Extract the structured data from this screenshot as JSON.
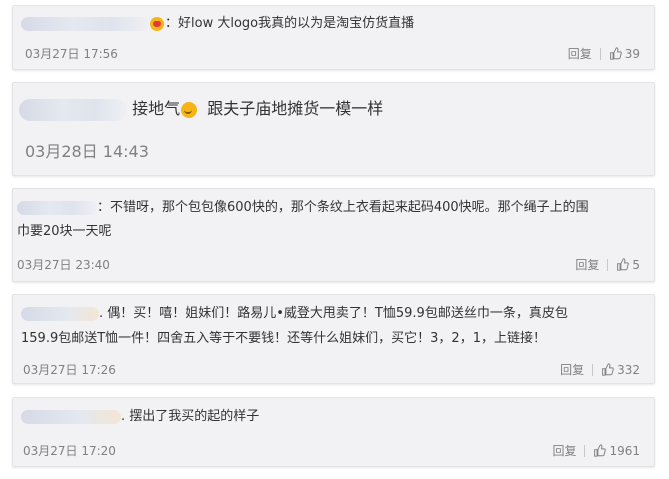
{
  "comments": [
    {
      "text_prefix": "：",
      "emoji": "heart-eyes-emoji",
      "text": "好low 大logo我真的以为是淘宝仿货直播",
      "time": "03月27日 17:56",
      "reply": "回复",
      "likes": "39"
    },
    {
      "text_a": "接地气",
      "emoji": "smile-emoji",
      "text_b": "跟夫子庙地摊货一模一样",
      "time": "03月28日 14:43"
    },
    {
      "text_line1": "：不错呀，那个包包像600快的，那个条纹上衣看起来起码400快呢。那个绳子上的围",
      "text_line2": "巾要20块一天呢",
      "time": "03月27日 23:40",
      "reply": "回复",
      "likes": "5"
    },
    {
      "text_line1": ". 偶！买！嘻！姐妹们！路易儿•威登大甩卖了！T恤59.9包邮送丝巾一条，真皮包",
      "text_line2": "159.9包邮送T恤一件！四舍五入等于不要钱！还等什么姐妹们，买它！3，2，1，上链接！",
      "time": "03月27日 17:26",
      "reply": "回复",
      "likes": "332"
    },
    {
      "text": ". 摆出了我买的起的样子",
      "time": "03月27日 17:20",
      "reply": "回复",
      "likes": "1961"
    }
  ]
}
